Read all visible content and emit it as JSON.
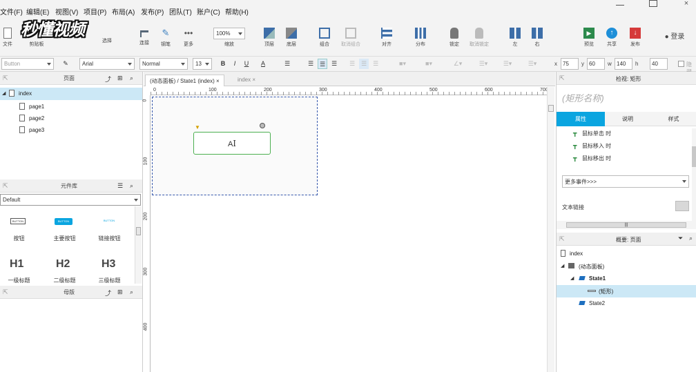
{
  "menu": [
    "文件(F)",
    "编辑(E)",
    "视图(V)",
    "项目(P)",
    "布局(A)",
    "发布(P)",
    "团队(T)",
    "账户(C)",
    "帮助(H)"
  ],
  "watermark": "秒懂视频",
  "toolbar": {
    "file": "文件",
    "clipboard": "剪贴板",
    "select": "选择",
    "connect": "连接",
    "pen": "钢笔",
    "more": "更多",
    "zoom": "100%",
    "zoom_label": "缩放",
    "top": "顶层",
    "bottom": "底层",
    "group": "组合",
    "ungroup": "取消组合",
    "align": "对齐",
    "distribute": "分布",
    "lock": "锁定",
    "unlock": "取消锁定",
    "left": "左",
    "right": "右",
    "preview": "预览",
    "share": "共享",
    "publish": "发布",
    "login": "登录"
  },
  "format": {
    "style": "Button",
    "font": "Arial",
    "weight": "Normal",
    "size": "13",
    "x_label": "x",
    "x": "75",
    "y_label": "y",
    "y": "60",
    "w_label": "w",
    "w": "140",
    "h_label": "h",
    "h": "40",
    "hide_label": "隐藏"
  },
  "pages_panel": {
    "title": "页面",
    "root": "index",
    "children": [
      "page1",
      "page2",
      "page3"
    ]
  },
  "library_panel": {
    "title": "元件库",
    "library": "Default",
    "items": [
      {
        "thumb": "BUTTON",
        "label": "按钮"
      },
      {
        "thumb": "BUTTON",
        "label": "主要按钮"
      },
      {
        "thumb": "BUTTON",
        "label": "链接按钮"
      },
      {
        "thumb": "H1",
        "label": "一级标题"
      },
      {
        "thumb": "H2",
        "label": "二级标题"
      },
      {
        "thumb": "H3",
        "label": "三级标题"
      }
    ]
  },
  "masters_panel": {
    "title": "母版"
  },
  "canvas": {
    "tabs": [
      "(动态面板) / State1 (index)",
      "index"
    ],
    "ruler_top": [
      "0",
      "100",
      "200",
      "300",
      "400",
      "500",
      "600",
      "700"
    ],
    "ruler_left": [
      "0",
      "100",
      "200",
      "300",
      "400"
    ],
    "shape_text": "A"
  },
  "inspector": {
    "title": "检视: 矩形",
    "shape_name_placeholder": "(矩形名称)",
    "tabs": [
      "属性",
      "说明",
      "样式"
    ],
    "events": [
      "鼠标单击 时",
      "鼠标移入 时",
      "鼠标移出 时"
    ],
    "more_events": "更多事件>>>",
    "text_link": "文本链接"
  },
  "outline": {
    "title": "概要: 页面",
    "items": [
      {
        "label": "index",
        "level": 0
      },
      {
        "label": "(动态面板)",
        "level": 1
      },
      {
        "label": "State1",
        "level": 2
      },
      {
        "label": "(矩形)",
        "level": 3
      },
      {
        "label": "State2",
        "level": 2
      }
    ]
  },
  "colors": {
    "accent": "#1aa0d8",
    "selected": "#cce8f6",
    "shape_border": "#4caf50",
    "tab_active": "#0aa5e0"
  }
}
